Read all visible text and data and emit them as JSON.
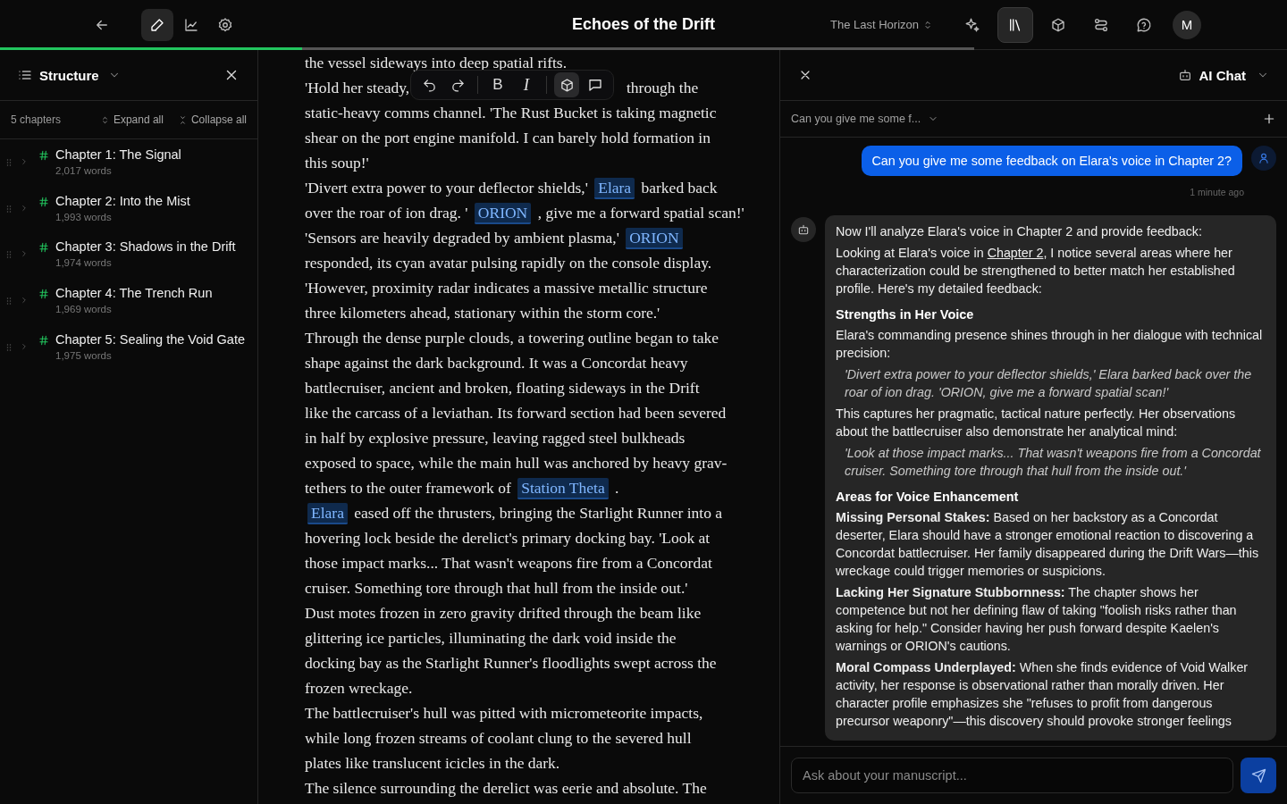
{
  "header": {
    "title": "Echoes of the Drift",
    "project": "The Last Horizon",
    "avatar": "M",
    "progress": {
      "level": 0.31
    },
    "left_tools": [
      {
        "selected": true
      },
      {
        "selected": false
      },
      {
        "selected": false
      }
    ],
    "right_tools": [
      {
        "selected": false
      },
      {
        "selected": true
      },
      {
        "selected": false
      },
      {
        "selected": false
      },
      {
        "selected": false
      }
    ]
  },
  "sidebar": {
    "title": "Structure",
    "count": "5 chapters",
    "expand": "Expand all",
    "collapse": "Collapse all",
    "chapters": [
      {
        "title": "Chapter 1: The Signal",
        "words": "2,017 words",
        "expanded": false
      },
      {
        "title": "Chapter 2: Into the Mist",
        "words": "1,993 words",
        "expanded": false
      },
      {
        "title": "Chapter 3: Shadows in the Drift",
        "words": "1,974 words",
        "expanded": false
      },
      {
        "title": "Chapter 4: The Trench Run",
        "words": "1,969 words",
        "expanded": false
      },
      {
        "title": "Chapter 5: Sealing the Void Gate",
        "words": "1,975 words",
        "expanded": false
      }
    ]
  },
  "editor": {
    "toolbar": [
      {
        "kind": "undo",
        "selected": false
      },
      {
        "kind": "redo",
        "selected": false
      },
      {
        "kind": "divider"
      },
      {
        "kind": "bold",
        "label": "B",
        "selected": false
      },
      {
        "kind": "italic",
        "label": "I",
        "selected": false
      },
      {
        "kind": "divider"
      },
      {
        "kind": "entity",
        "selected": true
      },
      {
        "kind": "comment",
        "selected": false
      }
    ],
    "lines": [
      [
        {
          "kind": "plain",
          "text": "the vessel sideways into deep spatial rifts."
        }
      ],
      [
        {
          "kind": "plain",
          "text": "'Hold her steady,"
        },
        {
          "kind": "after_toolbar",
          "text": "through the"
        }
      ],
      [
        {
          "kind": "plain",
          "text": "static-heavy comms channel. 'The Rust Bucket is taking magnetic"
        }
      ],
      [
        {
          "kind": "plain",
          "text": "shear on the port engine manifold. I can barely hold formation in"
        }
      ],
      [
        {
          "kind": "plain",
          "text": "this soup!'"
        }
      ],
      [
        {
          "kind": "plain",
          "text": "'Divert extra power to your deflector shields,'"
        },
        {
          "kind": "mention",
          "text": "Elara"
        },
        {
          "kind": "plain",
          "text": "barked back"
        }
      ],
      [
        {
          "kind": "plain",
          "text": "over the roar of ion drag. '"
        },
        {
          "kind": "mention",
          "text": "ORION"
        },
        {
          "kind": "plain",
          "text": ", give me a forward spatial scan!'"
        }
      ],
      [
        {
          "kind": "plain",
          "text": "'Sensors are heavily degraded by ambient plasma,'"
        },
        {
          "kind": "mention",
          "text": "ORION"
        }
      ],
      [
        {
          "kind": "plain",
          "text": "responded, its cyan avatar pulsing rapidly on the console display."
        }
      ],
      [
        {
          "kind": "plain",
          "text": "'However, proximity radar indicates a massive metallic structure"
        }
      ],
      [
        {
          "kind": "plain",
          "text": "three kilometers ahead, stationary within the storm core.'"
        }
      ],
      [
        {
          "kind": "plain",
          "text": "Through the dense purple clouds, a towering outline began to take"
        }
      ],
      [
        {
          "kind": "plain",
          "text": "shape against the dark background. It was a Concordat heavy"
        }
      ],
      [
        {
          "kind": "plain",
          "text": "battlecruiser, ancient and broken, floating sideways in the Drift"
        }
      ],
      [
        {
          "kind": "plain",
          "text": "like the carcass of a leviathan. Its forward section had been severed"
        }
      ],
      [
        {
          "kind": "plain",
          "text": "in half by explosive pressure, leaving ragged steel bulkheads"
        }
      ],
      [
        {
          "kind": "plain",
          "text": "exposed to space, while the main hull was anchored by heavy grav-"
        }
      ],
      [
        {
          "kind": "plain",
          "text": "tethers to the outer framework of"
        },
        {
          "kind": "mention",
          "text": "Station Theta"
        },
        {
          "kind": "plain",
          "text": "."
        }
      ],
      [
        {
          "kind": "mention",
          "text": "Elara"
        },
        {
          "kind": "plain",
          "text": "eased off the thrusters, bringing the Starlight Runner into a"
        }
      ],
      [
        {
          "kind": "plain",
          "text": "hovering lock beside the derelict's primary docking bay. 'Look at"
        }
      ],
      [
        {
          "kind": "plain",
          "text": "those impact marks... That wasn't weapons fire from a Concordat"
        }
      ],
      [
        {
          "kind": "plain",
          "text": "cruiser. Something tore through that hull from the inside out.'"
        }
      ],
      [
        {
          "kind": "plain",
          "text": "Dust motes frozen in zero gravity drifted through the beam like"
        }
      ],
      [
        {
          "kind": "plain",
          "text": "glittering ice particles, illuminating the dark void inside the"
        }
      ],
      [
        {
          "kind": "plain",
          "text": "docking bay as the Starlight Runner's floodlights swept across the"
        }
      ],
      [
        {
          "kind": "plain",
          "text": "frozen wreckage."
        }
      ],
      [
        {
          "kind": "plain",
          "text": "The battlecruiser's hull was pitted with micrometeorite impacts,"
        }
      ],
      [
        {
          "kind": "plain",
          "text": "while long frozen streams of coolant clung to the severed hull"
        }
      ],
      [
        {
          "kind": "plain",
          "text": "plates like translucent icicles in the dark."
        }
      ],
      [
        {
          "kind": "plain",
          "text": "The silence surrounding the derelict was eerie and absolute. The"
        }
      ]
    ]
  },
  "chat": {
    "title": "AI Chat",
    "conversation": "Can you give me some f...",
    "messages": [
      {
        "kind": "user",
        "text": "Can you give me some feedback on Elara's voice in Chapter 2?",
        "time": "1 minute ago"
      },
      {
        "kind": "assistant",
        "blocks": [
          {
            "kind": "paragraph",
            "parts": [
              {
                "text": "Now I'll analyze Elara's voice in Chapter 2 and provide feedback:"
              }
            ]
          },
          {
            "kind": "paragraph",
            "parts": [
              {
                "text": "Looking at Elara's voice in "
              },
              {
                "text": "Chapter 2",
                "link": true
              },
              {
                "text": ", I notice several areas where her characterization could be strengthened to better match her established profile. Here's my detailed feedback:"
              }
            ]
          },
          {
            "kind": "heading",
            "text": "Strengths in Her Voice"
          },
          {
            "kind": "paragraph",
            "parts": [
              {
                "text": "Elara's commanding presence shines through in her dialogue with technical precision:"
              }
            ]
          },
          {
            "kind": "quote",
            "text": "'Divert extra power to your deflector shields,' Elara barked back over the roar of ion drag. 'ORION, give me a forward spatial scan!'"
          },
          {
            "kind": "paragraph",
            "parts": [
              {
                "text": "This captures her pragmatic, tactical nature perfectly. Her observations about the battlecruiser also demonstrate her analytical mind:"
              }
            ]
          },
          {
            "kind": "quote",
            "text": "'Look at those impact marks... That wasn't weapons fire from a Concordat cruiser. Something tore through that hull from the inside out.'"
          },
          {
            "kind": "heading",
            "text": "Areas for Voice Enhancement"
          },
          {
            "kind": "paragraph",
            "parts": [
              {
                "text": "**Missing Personal Stakes:** Based on her backstory as a Concordat deserter, Elara should have a stronger emotional reaction to discovering a Concordat battlecruiser. Her family disappeared during the Drift Wars—this wreckage could trigger memories or suspicions."
              }
            ]
          },
          {
            "kind": "paragraph",
            "parts": [
              {
                "text": "**Lacking Her Signature Stubbornness:** The chapter shows her competence but not her defining flaw of taking \"foolish risks rather than asking for help.\" Consider having her push forward despite Kaelen's warnings or ORION's cautions."
              }
            ]
          },
          {
            "kind": "paragraph",
            "parts": [
              {
                "text": "**Moral Compass Underplayed:** When she finds evidence of Void Walker activity, her response is observational rather than morally driven. Her character profile emphasizes she \"refuses to profit from dangerous precursor weaponry\"—this discovery should provoke stronger feelings"
              }
            ]
          }
        ]
      }
    ],
    "input": {
      "placeholder": "Ask about your manuscript..."
    }
  }
}
